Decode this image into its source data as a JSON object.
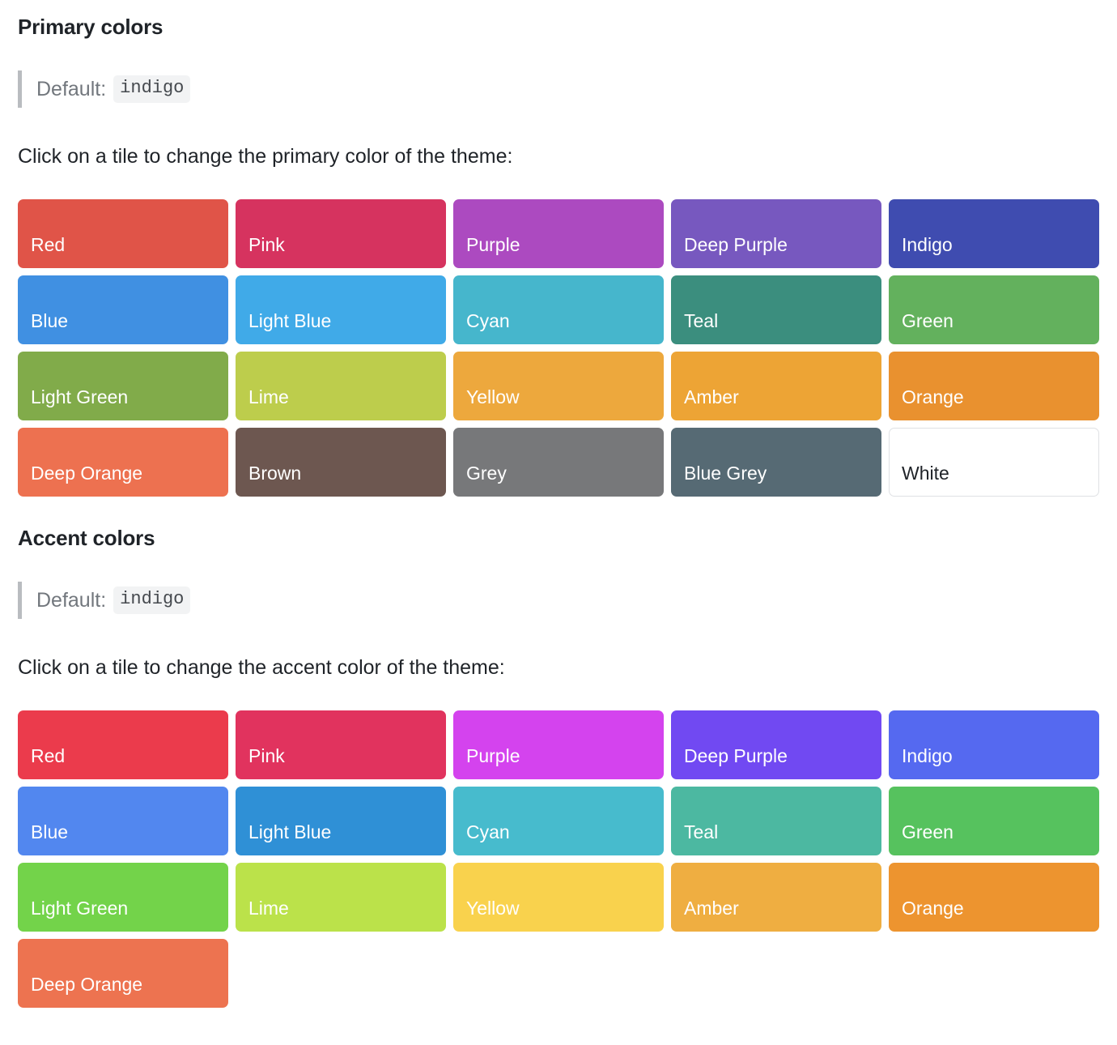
{
  "primary": {
    "title": "Primary colors",
    "default_label": "Default:",
    "default_value": "indigo",
    "instruction": "Click on a tile to change the primary color of the theme:",
    "tiles": [
      {
        "label": "Red",
        "color": "#e05448"
      },
      {
        "label": "Pink",
        "color": "#d6335f"
      },
      {
        "label": "Purple",
        "color": "#ac4ac0"
      },
      {
        "label": "Deep Purple",
        "color": "#7758bf"
      },
      {
        "label": "Indigo",
        "color": "#3f4cb0"
      },
      {
        "label": "Blue",
        "color": "#4090e2"
      },
      {
        "label": "Light Blue",
        "color": "#40aae8"
      },
      {
        "label": "Cyan",
        "color": "#46b6cc"
      },
      {
        "label": "Teal",
        "color": "#3b8e7e"
      },
      {
        "label": "Green",
        "color": "#63b15d"
      },
      {
        "label": "Light Green",
        "color": "#81ab4a"
      },
      {
        "label": "Lime",
        "color": "#bdcd4c"
      },
      {
        "label": "Yellow",
        "color": "#eda83d"
      },
      {
        "label": "Amber",
        "color": "#eda435"
      },
      {
        "label": "Orange",
        "color": "#e9912f"
      },
      {
        "label": "Deep Orange",
        "color": "#ed7150"
      },
      {
        "label": "Brown",
        "color": "#6d5750"
      },
      {
        "label": "Grey",
        "color": "#77787a"
      },
      {
        "label": "Blue Grey",
        "color": "#566a74"
      },
      {
        "label": "White",
        "color": "#ffffff",
        "is_white": true
      }
    ]
  },
  "accent": {
    "title": "Accent colors",
    "default_label": "Default:",
    "default_value": "indigo",
    "instruction": "Click on a tile to change the accent color of the theme:",
    "tiles": [
      {
        "label": "Red",
        "color": "#eb3b4c"
      },
      {
        "label": "Pink",
        "color": "#e1335e"
      },
      {
        "label": "Purple",
        "color": "#d443ee"
      },
      {
        "label": "Deep Purple",
        "color": "#7149f2"
      },
      {
        "label": "Indigo",
        "color": "#5569f0"
      },
      {
        "label": "Blue",
        "color": "#5287ef"
      },
      {
        "label": "Light Blue",
        "color": "#2f90d6"
      },
      {
        "label": "Cyan",
        "color": "#47bbcd"
      },
      {
        "label": "Teal",
        "color": "#4cb8a1"
      },
      {
        "label": "Green",
        "color": "#56c25e"
      },
      {
        "label": "Light Green",
        "color": "#73d34a"
      },
      {
        "label": "Lime",
        "color": "#bbe24a"
      },
      {
        "label": "Yellow",
        "color": "#f9d24d"
      },
      {
        "label": "Amber",
        "color": "#efae41"
      },
      {
        "label": "Orange",
        "color": "#ed942f"
      },
      {
        "label": "Deep Orange",
        "color": "#ed7350"
      }
    ]
  }
}
